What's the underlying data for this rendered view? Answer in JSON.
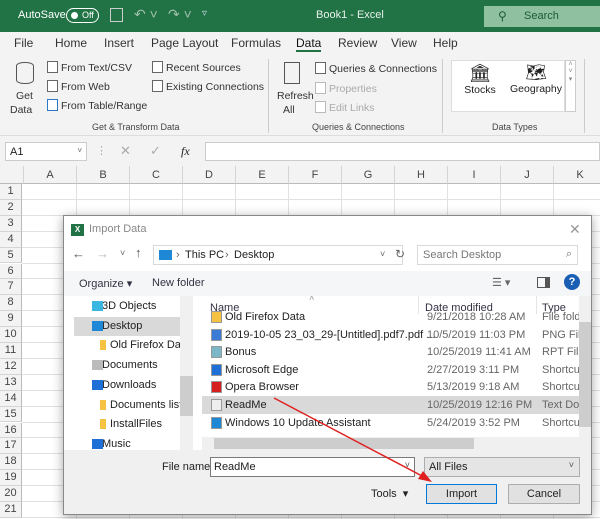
{
  "titlebar": {
    "autosave": "AutoSave",
    "toggle": "Off",
    "title": "Book1  -  Excel",
    "search": "Search"
  },
  "tabs": [
    "File",
    "Home",
    "Insert",
    "Page Layout",
    "Formulas",
    "Data",
    "Review",
    "View",
    "Help"
  ],
  "active_tab": "Data",
  "ribbon": {
    "get_data": [
      "Get",
      "Data"
    ],
    "from_text": "From Text/CSV",
    "from_web": "From Web",
    "from_table": "From Table/Range",
    "recent": "Recent Sources",
    "existing": "Existing Connections",
    "group1": "Get & Transform Data",
    "refresh": [
      "Refresh",
      "All"
    ],
    "queries": "Queries & Connections",
    "properties": "Properties",
    "edit_links": "Edit Links",
    "group2": "Queries & Connections",
    "stocks": "Stocks",
    "geography": "Geography",
    "group3": "Data Types"
  },
  "formula_bar": {
    "name_box": "A1",
    "fx": "fx",
    "value": ""
  },
  "columns": [
    "A",
    "B",
    "C",
    "D",
    "E",
    "F",
    "G",
    "H",
    "I",
    "J",
    "K"
  ],
  "rows": [
    "1",
    "2",
    "3",
    "4",
    "5",
    "6",
    "7",
    "8",
    "9",
    "10",
    "11",
    "12",
    "13",
    "14",
    "15",
    "16",
    "17",
    "18",
    "19",
    "20",
    "21"
  ],
  "dialog": {
    "title": "Import Data",
    "path": [
      "This PC",
      "Desktop"
    ],
    "search_placeholder": "Search Desktop",
    "organize": "Organize",
    "new_folder": "New folder",
    "nav": [
      {
        "label": "3D Objects",
        "icon": "3d-objects-icon"
      },
      {
        "label": "Desktop",
        "icon": "desktop-icon",
        "selected": true
      },
      {
        "label": "Old Firefox Dat",
        "icon": "folder-icon",
        "indent": true
      },
      {
        "label": "Documents",
        "icon": "documents-icon"
      },
      {
        "label": "Downloads",
        "icon": "download-icon"
      },
      {
        "label": "Documents list",
        "icon": "folder-icon",
        "indent": true
      },
      {
        "label": "InstallFiles",
        "icon": "folder-icon",
        "indent": true
      },
      {
        "label": "Music",
        "icon": "music-icon"
      }
    ],
    "columns": {
      "name": "Name",
      "date": "Date modified",
      "type": "Type"
    },
    "files": [
      {
        "name": "Old Firefox Data",
        "date": "9/21/2018 10:28 AM",
        "type": "File folder",
        "icon": "folder-icon"
      },
      {
        "name": "2019-10-05 23_03_29-[Untitled].pdf7.pdf ...",
        "date": "10/5/2019 11:03 PM",
        "type": "PNG File",
        "icon": "image-file-icon"
      },
      {
        "name": "Bonus",
        "date": "10/25/2019 11:41 AM",
        "type": "RPT File",
        "icon": "rpt-file-icon"
      },
      {
        "name": "Microsoft Edge",
        "date": "2/27/2019 3:11 PM",
        "type": "Shortcut",
        "icon": "edge-icon"
      },
      {
        "name": "Opera Browser",
        "date": "5/13/2019 9:18 AM",
        "type": "Shortcut",
        "icon": "opera-icon"
      },
      {
        "name": "ReadMe",
        "date": "10/25/2019 12:16 PM",
        "type": "Text Document",
        "icon": "text-file-icon",
        "selected": true
      },
      {
        "name": "Windows 10 Update Assistant",
        "date": "5/24/2019 3:52 PM",
        "type": "Shortcut",
        "icon": "windows-icon"
      }
    ],
    "file_name_label": "File name:",
    "file_name": "ReadMe",
    "filter": "All Files",
    "tools": "Tools",
    "import": "Import",
    "cancel": "Cancel"
  },
  "colors": {
    "excel_green": "#217346",
    "arrow": "#e02020",
    "help": "#1a5fb4"
  }
}
